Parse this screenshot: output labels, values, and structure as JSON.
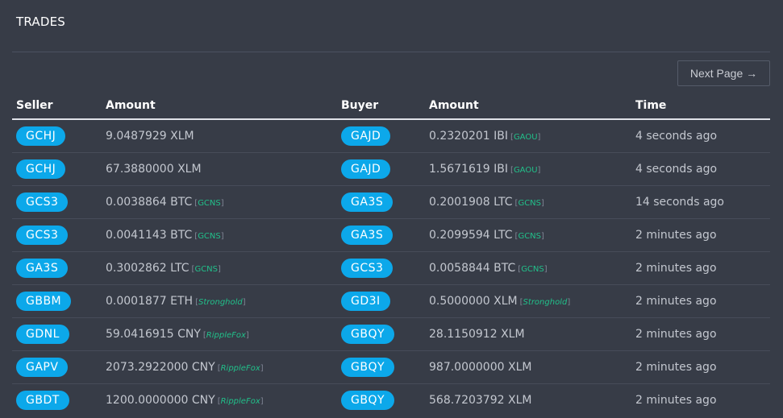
{
  "header": {
    "title": "TRADES"
  },
  "pagination": {
    "next_label": "Next Page →"
  },
  "columns": [
    "Seller",
    "Amount",
    "Buyer",
    "Amount",
    "Time"
  ],
  "rows": [
    {
      "seller": "GCHJ",
      "sell_amount": "9.0487929 XLM",
      "sell_issuer": "",
      "sell_issuer_italic": false,
      "buyer": "GAJD",
      "buy_amount": "0.2320201 IBI",
      "buy_issuer": "GAOU",
      "buy_issuer_italic": false,
      "time": "4 seconds ago"
    },
    {
      "seller": "GCHJ",
      "sell_amount": "67.3880000 XLM",
      "sell_issuer": "",
      "sell_issuer_italic": false,
      "buyer": "GAJD",
      "buy_amount": "1.5671619 IBI",
      "buy_issuer": "GAOU",
      "buy_issuer_italic": false,
      "time": "4 seconds ago"
    },
    {
      "seller": "GCS3",
      "sell_amount": "0.0038864 BTC",
      "sell_issuer": "GCNS",
      "sell_issuer_italic": false,
      "buyer": "GA3S",
      "buy_amount": "0.2001908 LTC",
      "buy_issuer": "GCNS",
      "buy_issuer_italic": false,
      "time": "14 seconds ago"
    },
    {
      "seller": "GCS3",
      "sell_amount": "0.0041143 BTC",
      "sell_issuer": "GCNS",
      "sell_issuer_italic": false,
      "buyer": "GA3S",
      "buy_amount": "0.2099594 LTC",
      "buy_issuer": "GCNS",
      "buy_issuer_italic": false,
      "time": "2 minutes ago"
    },
    {
      "seller": "GA3S",
      "sell_amount": "0.3002862 LTC",
      "sell_issuer": "GCNS",
      "sell_issuer_italic": false,
      "buyer": "GCS3",
      "buy_amount": "0.0058844 BTC",
      "buy_issuer": "GCNS",
      "buy_issuer_italic": false,
      "time": "2 minutes ago"
    },
    {
      "seller": "GBBM",
      "sell_amount": "0.0001877 ETH",
      "sell_issuer": "Stronghold",
      "sell_issuer_italic": true,
      "buyer": "GD3I",
      "buy_amount": "0.5000000 XLM",
      "buy_issuer": "Stronghold",
      "buy_issuer_italic": true,
      "time": "2 minutes ago"
    },
    {
      "seller": "GDNL",
      "sell_amount": "59.0416915 CNY",
      "sell_issuer": "RippleFox",
      "sell_issuer_italic": true,
      "buyer": "GBQY",
      "buy_amount": "28.1150912 XLM",
      "buy_issuer": "",
      "buy_issuer_italic": false,
      "time": "2 minutes ago"
    },
    {
      "seller": "GAPV",
      "sell_amount": "2073.2922000 CNY",
      "sell_issuer": "RippleFox",
      "sell_issuer_italic": true,
      "buyer": "GBQY",
      "buy_amount": "987.0000000 XLM",
      "buy_issuer": "",
      "buy_issuer_italic": false,
      "time": "2 minutes ago"
    },
    {
      "seller": "GBDT",
      "sell_amount": "1200.0000000 CNY",
      "sell_issuer": "RippleFox",
      "sell_issuer_italic": true,
      "buyer": "GBQY",
      "buy_amount": "568.7203792 XLM",
      "buy_issuer": "",
      "buy_issuer_italic": false,
      "time": "2 minutes ago"
    }
  ],
  "colors": {
    "background": "#373c47",
    "account_badge": "#0ca8ea",
    "issuer_text": "#21c08a",
    "header_text": "#ffffff"
  }
}
